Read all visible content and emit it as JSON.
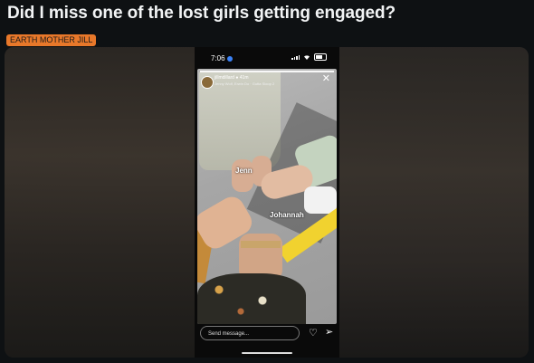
{
  "post": {
    "title": "Did I miss one of the lost girls getting engaged?",
    "flair": "EARTH MOTHER JILL"
  },
  "phone": {
    "time": "7:06",
    "story": {
      "username": "jillmdillard",
      "age": "41m",
      "sub": "Jenny Wolf, Erwin Do · Gutta Sloop 2",
      "tags": [
        "Jenn",
        "Johannah"
      ]
    },
    "reply_placeholder": "Send message..."
  },
  "colors": {
    "flair_bg": "#e8782a",
    "page_bg": "#0e1113"
  }
}
